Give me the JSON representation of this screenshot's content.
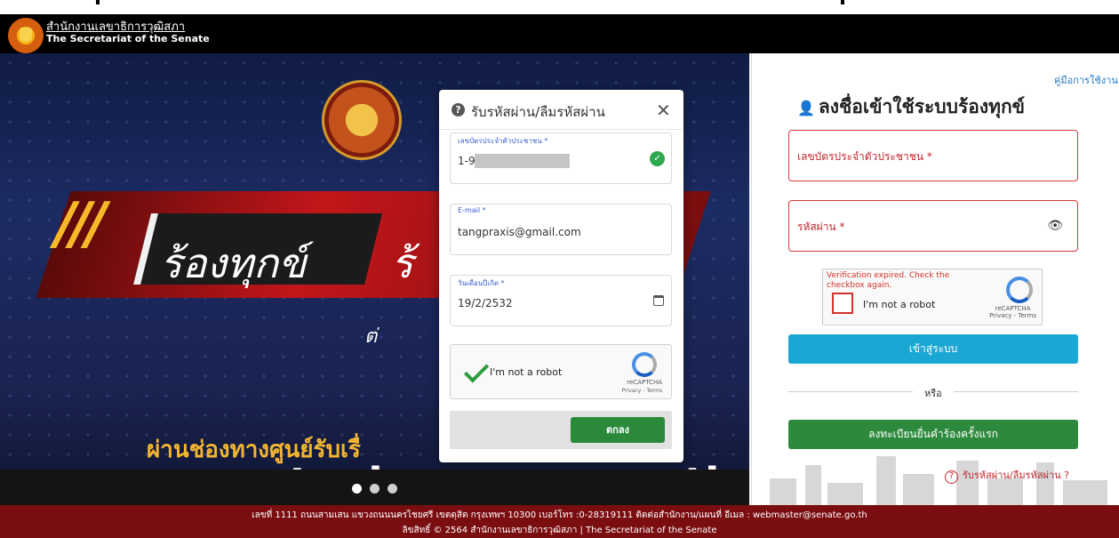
{
  "header": {
    "title_th": "สำนักงานเลขาธิการวุฒิสภา",
    "title_en": "The Secretariat of the Senate"
  },
  "banner": {
    "main_text_1": "ร้องทุกข์",
    "main_text_2": "ร้",
    "sub_text": "ต่",
    "channel_text": "ผ่านช่องทางศูนย์รับเรื่",
    "url_text_1": "www.rongtook.s",
    "url_text_2": "th",
    "slides": 3,
    "active_slide": 1
  },
  "login": {
    "manual_link": "คู่มือการใช้งาน",
    "title": "ลงชื่อเข้าใช้ระบบร้องทุกข์",
    "id_label": "เลขบัตรประจำตัวประชาชน *",
    "password_label": "รหัสผ่าน *",
    "recaptcha": {
      "error": "Verification expired. Check the checkbox again.",
      "label": "I'm not a robot",
      "brand": "reCAPTCHA",
      "terms": "Privacy - Terms"
    },
    "login_button": "เข้าสู่ระบบ",
    "or_text": "หรือ",
    "register_button": "ลงทะเบียนยื่นคำร้องครั้งแรก",
    "forgot_link": "รับรหัสผ่าน/ลืมรหัสผ่าน ?"
  },
  "modal": {
    "title": "รับรหัสผ่าน/ลืมรหัสผ่าน",
    "id_field": {
      "label": "เลขบัตรประจำตัวประชาชน *",
      "value": "1-96"
    },
    "email_field": {
      "label": "E-mail *",
      "value": "tangpraxis@gmail.com"
    },
    "dob_field": {
      "label": "วันเดือนปีเกิด *",
      "value": "19/2/2532"
    },
    "recaptcha": {
      "label": "I'm not a robot",
      "brand": "reCAPTCHA",
      "terms": "Privacy - Terms"
    },
    "ok_button": "ตกลง"
  },
  "footer": {
    "line1": "เลขที่ 1111 ถนนสามเสน แขวงถนนนครไชยศรี เขตดุสิต กรุงเทพฯ 10300 เบอร์โทร :0-28319111 ติดต่อสำนักงาน/แผนที่ อีเมล : webmaster@senate.go.th",
    "line2": "ลิขสิทธิ์ © 2564 สำนักงานเลขาธิการวุฒิสภา | The Secretariat of the Senate"
  },
  "colors": {
    "header_bg": "#000000",
    "footer_bg": "#7a0d10",
    "login_button": "#1aa7d4",
    "register_button": "#2d8a3d",
    "ok_button": "#2a8a3a",
    "error_red": "#c0272d"
  }
}
